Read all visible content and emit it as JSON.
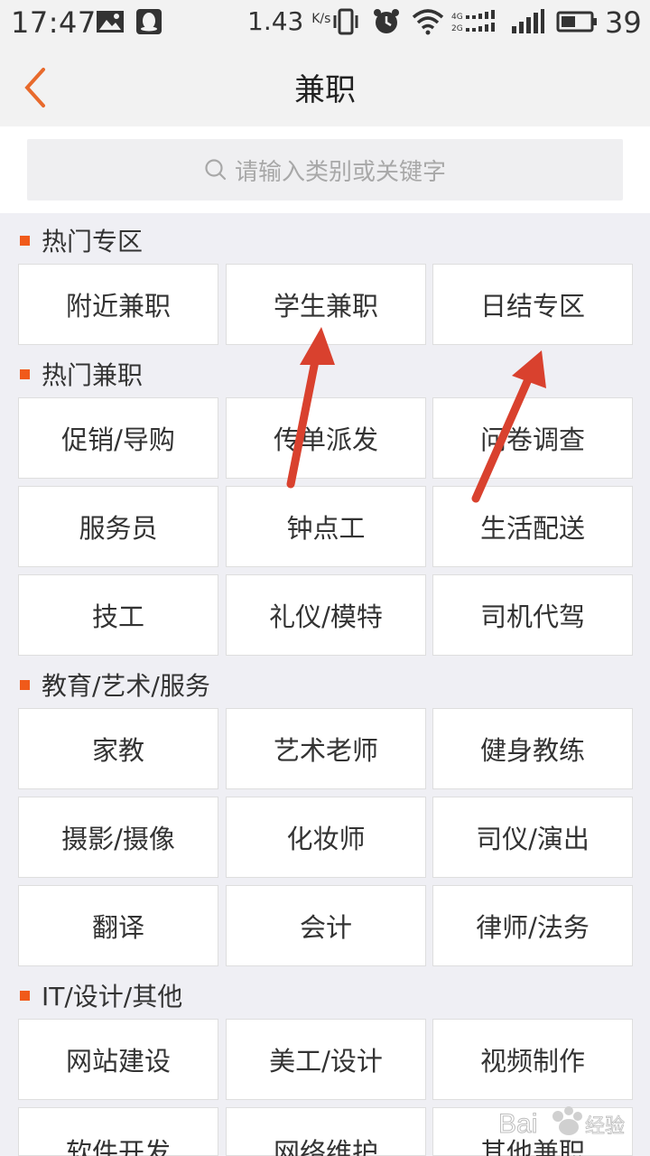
{
  "status_bar": {
    "time": "17:47",
    "speed": "1.43",
    "speed_unit": "K/s",
    "battery": "39"
  },
  "header": {
    "title": "兼职",
    "back_icon": "chevron-left-icon"
  },
  "search": {
    "placeholder": "请输入类别或关键字",
    "icon": "search-icon"
  },
  "colors": {
    "accent": "#f05a1a",
    "back_icon": "#e86a2c",
    "arrow": "#d9412e"
  },
  "sections": [
    {
      "title": "热门专区",
      "items": [
        "附近兼职",
        "学生兼职",
        "日结专区"
      ]
    },
    {
      "title": "热门兼职",
      "items": [
        "促销/导购",
        "传单派发",
        "问卷调查",
        "服务员",
        "钟点工",
        "生活配送",
        "技工",
        "礼仪/模特",
        "司机代驾"
      ]
    },
    {
      "title": "教育/艺术/服务",
      "items": [
        "家教",
        "艺术老师",
        "健身教练",
        "摄影/摄像",
        "化妆师",
        "司仪/演出",
        "翻译",
        "会计",
        "律师/法务"
      ]
    },
    {
      "title": "IT/设计/其他",
      "items": [
        "网站建设",
        "美工/设计",
        "视频制作",
        "软件开发",
        "网络维护",
        "其他兼职"
      ]
    }
  ],
  "watermark": "Bai经验"
}
